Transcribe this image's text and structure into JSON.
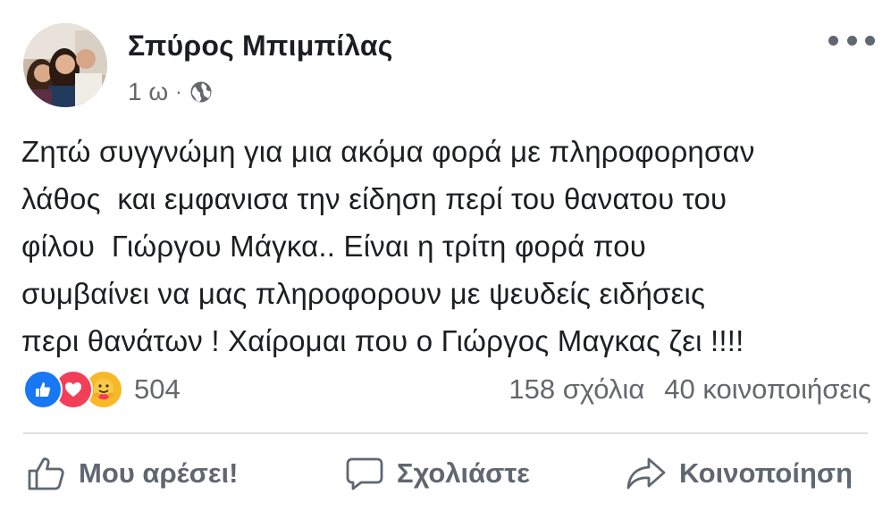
{
  "post": {
    "author": "Σπύρος Μπιμπίλας",
    "time": "1 ω",
    "separator": "·",
    "privacy_icon": "globe-icon",
    "text_lines": [
      "Ζητώ συγγνώμη για μια ακόμα φορά με πληροφορησαν",
      "λάθος  και εμφανισα την είδηση περί του θανατου του",
      "φίλου  Γιώργου Μάγκα.. Είναι η τρίτη φορά που",
      "συμβαίνει να μας πληροφορουν με ψευδείς ειδήσεις",
      "περι θανάτων ! Χαίρομαι που ο Γιώργος Μαγκας ζει !!!!"
    ],
    "reactions": {
      "icons": [
        "like-icon",
        "love-icon",
        "care-icon"
      ],
      "count": "504"
    },
    "comments": "158 σχόλια",
    "shares": "40 κοινοποιήσεις",
    "actions": {
      "like": "Μου αρέσει!",
      "comment": "Σχολιάστε",
      "share": "Κοινοποίηση"
    },
    "colors": {
      "like_blue": "#1877f2",
      "love_red": "#f33e58",
      "care_yellow": "#f7b928",
      "secondary_text": "#65676b"
    }
  }
}
